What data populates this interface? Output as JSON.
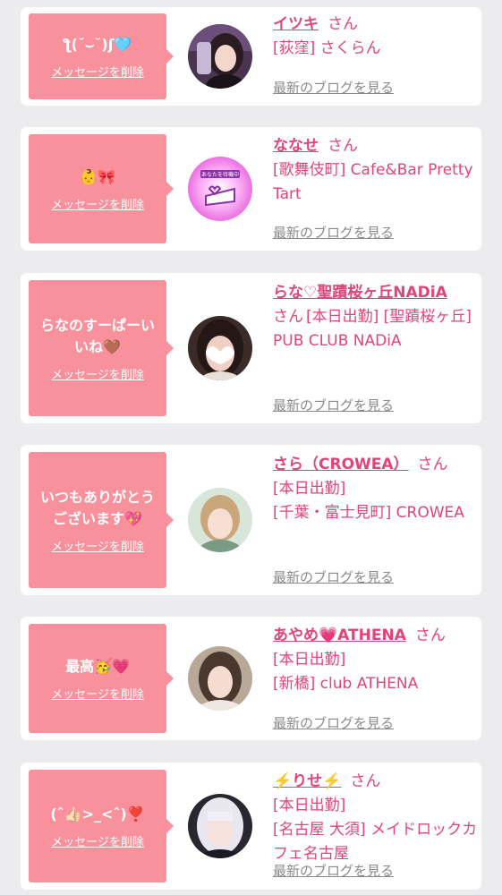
{
  "colors": {
    "background": "#ececee",
    "card": "#ffffff",
    "bubble": "#f8919c",
    "accent_text": "#e0457a",
    "link_gray": "#8a8a8a"
  },
  "cards": [
    {
      "message": "ƪ(˘⌣˘)ʃ🩵",
      "delete_label": "メッセージを削除",
      "name": "イツキ",
      "san": "さん",
      "shop": "[荻窪] さくらん",
      "blog_label": "最新のブログを見る",
      "avatar_icon": "girl-portrait"
    },
    {
      "message": "👶🎀",
      "delete_label": "メッセージを削除",
      "name": "ななせ",
      "san": "さん",
      "shop": "[歌舞伎町] Cafe&Bar Pretty Tart",
      "blog_label": "最新のブログを見る",
      "avatar_icon": "cake-heart-logo",
      "avatar_text": "あなたを待機中"
    },
    {
      "message": "らなのすーぱーいいね🤎",
      "delete_label": "メッセージを削除",
      "name": "らな♡聖蹟桜ヶ丘NADiA",
      "san": "さん",
      "shop": "[本日出勤]\n[聖蹟桜ヶ丘] PUB CLUB NADiA",
      "blog_label": "最新のブログを見る",
      "avatar_icon": "girl-portrait-heart"
    },
    {
      "message": "いつもありがとうございます💖",
      "delete_label": "メッセージを削除",
      "name": "さら（CROWEA）",
      "san": "さん",
      "shop": "[本日出勤]\n[千葉・富士見町] CROWEA",
      "blog_label": "最新のブログを見る",
      "avatar_icon": "girl-portrait"
    },
    {
      "message": "最高🥳💗",
      "delete_label": "メッセージを削除",
      "name": "あやめ💗ATHENA",
      "san": "さん",
      "shop": "[本日出勤]\n[新橋] club ATHENA",
      "blog_label": "最新のブログを見る",
      "avatar_icon": "girl-portrait"
    },
    {
      "message": "(ˆ👍🏻>_<ˆ)❣️",
      "delete_label": "メッセージを削除",
      "name": "⚡️りせ⚡️",
      "san": "さん",
      "shop": "[本日出勤]\n[名古屋 大須] メイドロックカフェ名古屋",
      "blog_label": "最新のブログを見る",
      "avatar_icon": "girl-portrait-silver-hair"
    }
  ]
}
